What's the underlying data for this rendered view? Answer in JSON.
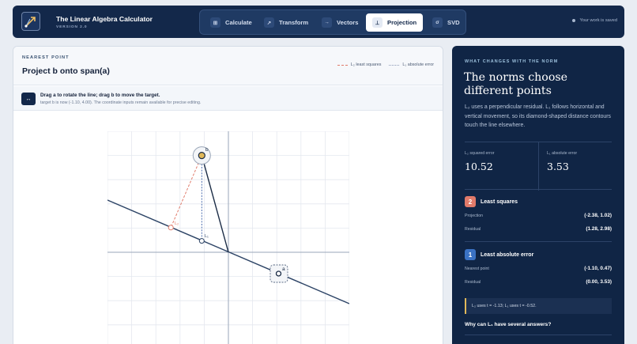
{
  "app": {
    "title": "The Linear Algebra Calculator",
    "version": "VERSION 2.0",
    "save_status": "Your work is saved"
  },
  "nav": {
    "tabs": [
      {
        "label": "Calculate",
        "icon": "⊞"
      },
      {
        "label": "Transform",
        "icon": "↗"
      },
      {
        "label": "Vectors",
        "icon": "→"
      },
      {
        "label": "Projection",
        "icon": "⊥"
      },
      {
        "label": "SVD",
        "icon": "σ"
      }
    ],
    "active": "Projection"
  },
  "main": {
    "eyebrow": "NEAREST POINT",
    "title": "Project b onto span(a)",
    "legend": {
      "l2": "L₂ least squares",
      "l1": "L₁ absolute error",
      "l2_color": "#e07a6a",
      "l1_color": "#8a98b4"
    },
    "hint_title": "Drag a to rotate the line; drag b to move the target.",
    "hint_detail": "target b is now (-1.10, 4.00). The coordinate inputs remain available for precise editing.",
    "plot_labels": {
      "b": "b",
      "a": "a",
      "l2": "L₂",
      "l1": "L₁"
    }
  },
  "panel": {
    "eyebrow": "WHAT CHANGES WITH THE NORM",
    "title": "The norms choose different points",
    "description": "L₂ uses a perpendicular residual. L₁ follows horizontal and vertical movement, so its diamond-shaped distance contours touch the line elsewhere.",
    "metrics": [
      {
        "label": "L₂ squared error",
        "value": "10.52"
      },
      {
        "label": "L₁ absolute error",
        "value": "3.53"
      }
    ],
    "least_squares": {
      "badge": "2",
      "title": "Least squares",
      "rows": [
        {
          "key": "Projection",
          "value": "(-2.38, 1.02)"
        },
        {
          "key": "Residual",
          "value": "(1.28, 2.98)"
        }
      ]
    },
    "least_absolute": {
      "badge": "1",
      "title": "Least absolute error",
      "rows": [
        {
          "key": "Nearest point",
          "value": "(-1.10, 0.47)"
        },
        {
          "key": "Residual",
          "value": "(0.00, 3.53)"
        }
      ]
    },
    "note": "L₂ uses t = -1.13; L₁ uses t = -0.52.",
    "why": "Why can L₁ have several answers?"
  }
}
